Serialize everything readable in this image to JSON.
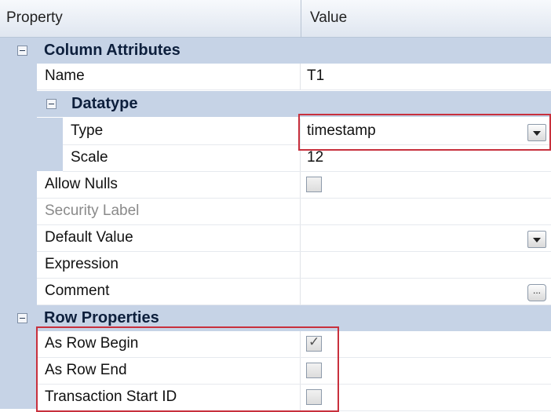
{
  "header": {
    "property": "Property",
    "value": "Value"
  },
  "categories": {
    "column_attributes": "Column Attributes",
    "datatype": "Datatype",
    "row_properties": "Row Properties"
  },
  "rows": {
    "name": {
      "label": "Name",
      "value": "T1"
    },
    "type": {
      "label": "Type",
      "value": "timestamp"
    },
    "scale": {
      "label": "Scale",
      "value": "12"
    },
    "allow_nulls": {
      "label": "Allow Nulls",
      "checked": false
    },
    "security_label": {
      "label": "Security Label"
    },
    "default_value": {
      "label": "Default Value",
      "value": ""
    },
    "expression": {
      "label": "Expression"
    },
    "comment": {
      "label": "Comment",
      "button": "..."
    },
    "as_row_begin": {
      "label": "As Row Begin",
      "checked": true
    },
    "as_row_end": {
      "label": "As Row End",
      "checked": false
    },
    "transaction_start_id": {
      "label": "Transaction Start ID",
      "checked": false
    }
  },
  "colors": {
    "category_bg": "#c6d3e6",
    "highlight": "#c8303d"
  }
}
